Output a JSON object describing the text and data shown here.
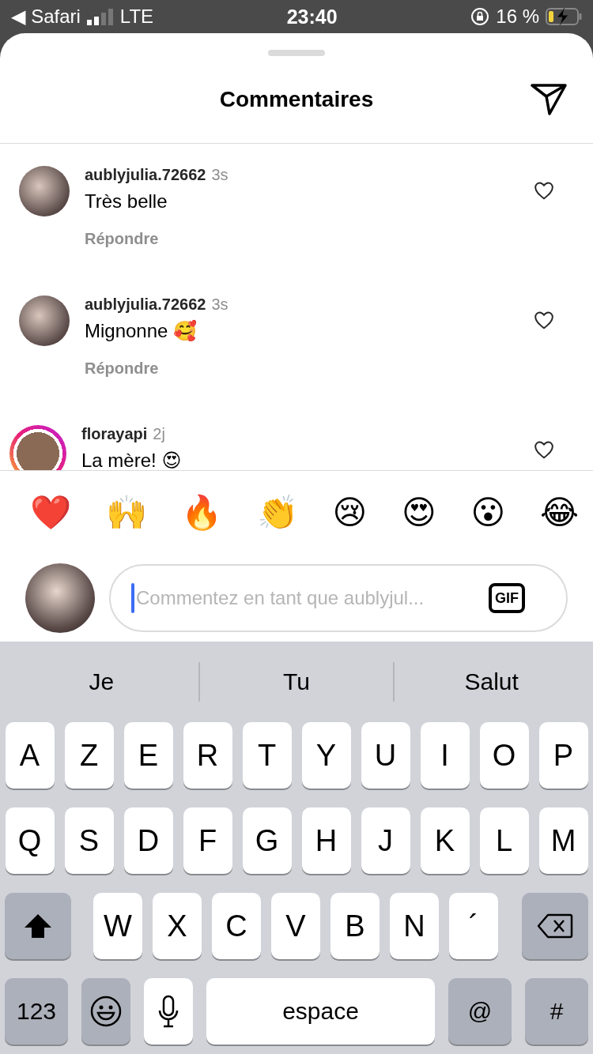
{
  "status_bar": {
    "back_app": "◀ Safari",
    "network": "LTE",
    "time": "23:40",
    "battery_percent": "16 %",
    "charging": true
  },
  "sheet": {
    "title": "Commentaires"
  },
  "comments": [
    {
      "username": "aublyjulia.72662",
      "time": "3s",
      "text": "Très belle",
      "reply": "Répondre",
      "story_ring": false,
      "liked": false
    },
    {
      "username": "aublyjulia.72662",
      "time": "3s",
      "text": "Mignonne 🥰",
      "reply": "Répondre",
      "story_ring": false,
      "liked": false
    },
    {
      "username": "florayapi",
      "time": "2j",
      "text": "La mère! 😍",
      "story_ring": true,
      "liked": false
    }
  ],
  "reactions": [
    "❤️",
    "🙌",
    "🔥",
    "👏",
    "😢",
    "😍",
    "😮",
    "😂"
  ],
  "composer": {
    "placeholder": "Commentez en tant que aublyjul...",
    "gif": "GIF"
  },
  "keyboard": {
    "suggestions": [
      "Je",
      "Tu",
      "Salut"
    ],
    "rows": [
      {
        "keys": [
          {
            "kind": "letter",
            "label": "A"
          },
          {
            "kind": "letter",
            "label": "Z"
          },
          {
            "kind": "letter",
            "label": "E"
          },
          {
            "kind": "letter",
            "label": "R"
          },
          {
            "kind": "letter",
            "label": "T"
          },
          {
            "kind": "letter",
            "label": "Y"
          },
          {
            "kind": "letter",
            "label": "U"
          },
          {
            "kind": "letter",
            "label": "I"
          },
          {
            "kind": "letter",
            "label": "O"
          },
          {
            "kind": "letter",
            "label": "P"
          }
        ]
      },
      {
        "keys": [
          {
            "kind": "letter",
            "label": "Q"
          },
          {
            "kind": "letter",
            "label": "S"
          },
          {
            "kind": "letter",
            "label": "D"
          },
          {
            "kind": "letter",
            "label": "F"
          },
          {
            "kind": "letter",
            "label": "G"
          },
          {
            "kind": "letter",
            "label": "H"
          },
          {
            "kind": "letter",
            "label": "J"
          },
          {
            "kind": "letter",
            "label": "K"
          },
          {
            "kind": "letter",
            "label": "L"
          },
          {
            "kind": "letter",
            "label": "M"
          }
        ]
      },
      {
        "keys": [
          {
            "kind": "shift"
          },
          {
            "kind": "letter",
            "label": "W"
          },
          {
            "kind": "letter",
            "label": "X"
          },
          {
            "kind": "letter",
            "label": "C"
          },
          {
            "kind": "letter",
            "label": "V"
          },
          {
            "kind": "letter",
            "label": "B"
          },
          {
            "kind": "letter",
            "label": "N"
          },
          {
            "kind": "letter",
            "label": "´"
          },
          {
            "kind": "backspace"
          }
        ]
      },
      {
        "keys": [
          {
            "kind": "mode",
            "label": "123"
          },
          {
            "kind": "emoji"
          },
          {
            "kind": "mic"
          },
          {
            "kind": "space",
            "label": "espace"
          },
          {
            "kind": "mode",
            "label": "@"
          },
          {
            "kind": "mode",
            "label": "#"
          }
        ]
      }
    ]
  }
}
